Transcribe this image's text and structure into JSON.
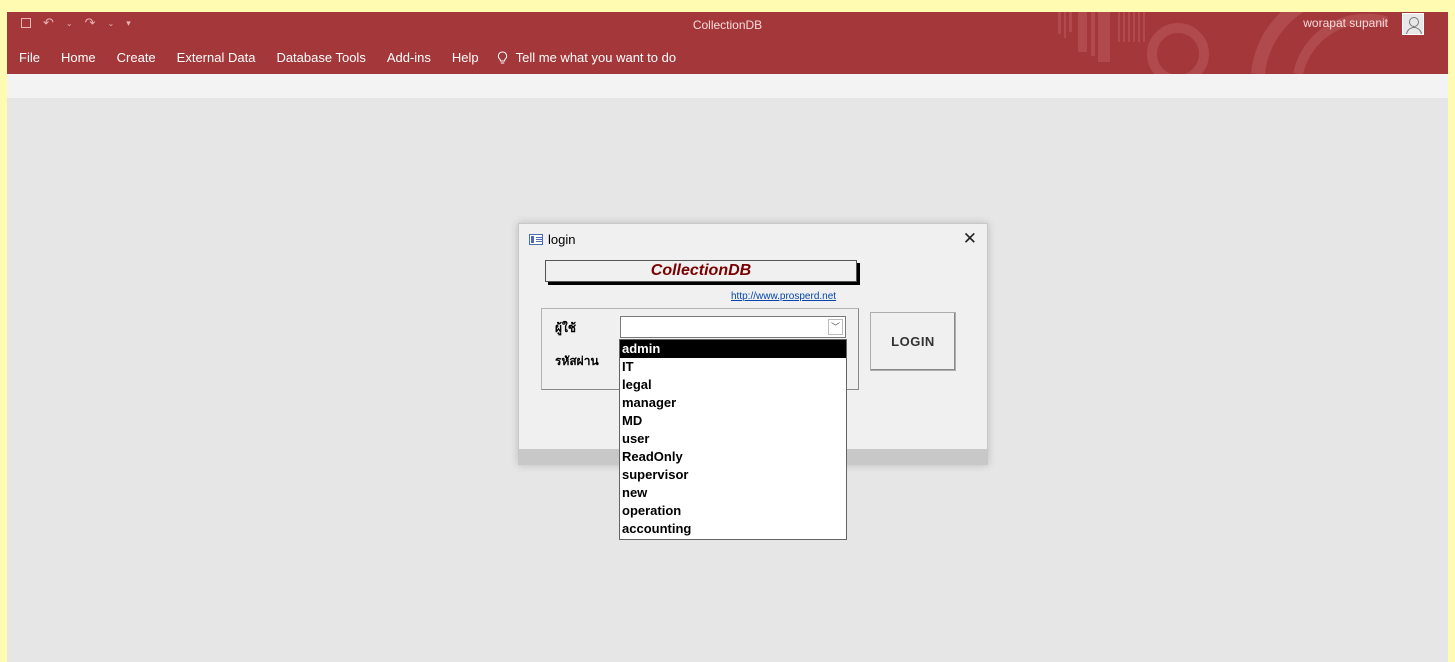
{
  "window": {
    "app_title": "CollectionDB",
    "user_name": "worapat supanit",
    "menu": [
      "File",
      "Home",
      "Create",
      "External Data",
      "Database Tools",
      "Add-ins",
      "Help"
    ],
    "tell_me": "Tell me what you want to do"
  },
  "dialog": {
    "title": "login",
    "banner": "CollectionDB",
    "link": "http://www.prosperd.net",
    "user_label": "ผู้ใช้",
    "password_label": "รหัสผ่าน",
    "user_value": "",
    "login_button": "LOGIN"
  },
  "dropdown": {
    "options": [
      "admin",
      "IT",
      "legal",
      "manager",
      "MD",
      "user",
      "ReadOnly",
      "supervisor",
      "new",
      "operation",
      "accounting"
    ],
    "selected": "admin"
  },
  "colors": {
    "title_bar": "#a4373a",
    "workspace": "#e6e6e6",
    "dialog": "#f0f0f0",
    "banner_text": "#7a0000"
  }
}
